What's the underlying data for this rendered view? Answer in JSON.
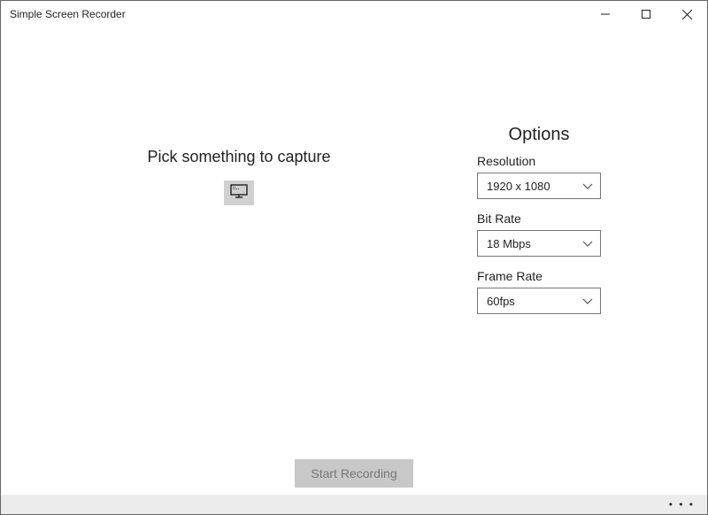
{
  "titlebar": {
    "title": "Simple Screen Recorder"
  },
  "left": {
    "heading": "Pick something to capture"
  },
  "options": {
    "title": "Options",
    "resolution": {
      "label": "Resolution",
      "value": "1920 x 1080"
    },
    "bitrate": {
      "label": "Bit Rate",
      "value": "18 Mbps"
    },
    "framerate": {
      "label": "Frame Rate",
      "value": "60fps"
    }
  },
  "footer": {
    "start_label": "Start Recording"
  }
}
